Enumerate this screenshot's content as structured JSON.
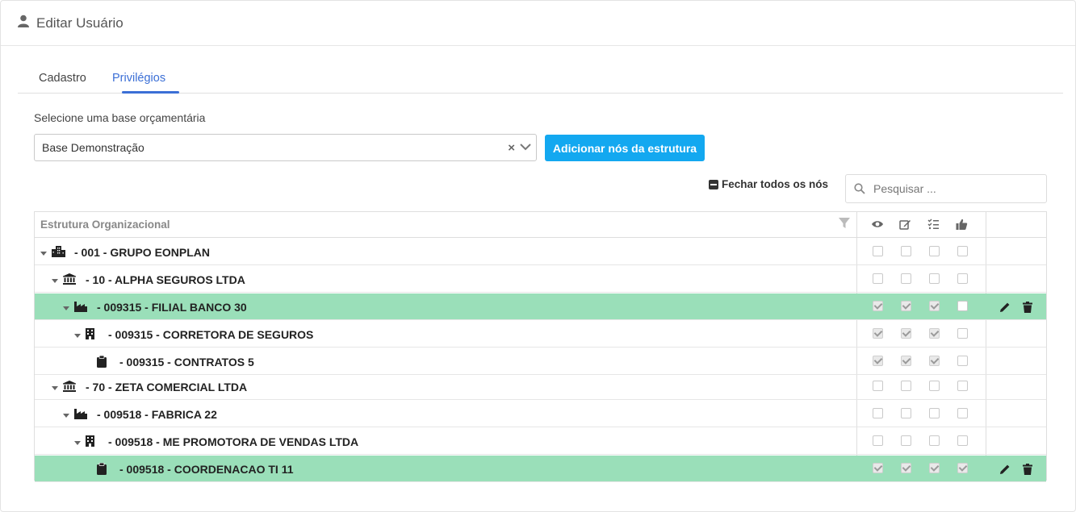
{
  "header": {
    "title": "Editar Usuário",
    "icon": "user-icon"
  },
  "tabs": [
    {
      "label": "Cadastro",
      "active": false
    },
    {
      "label": "Privilégios",
      "active": true
    }
  ],
  "base": {
    "label": "Selecione uma base orçamentária",
    "selected": "Base Demonstração",
    "clear_glyph": "×",
    "add_button": "Adicionar nós da estrutura"
  },
  "toolbar": {
    "close_all_label": "Fechar todos os nós",
    "search_placeholder": "Pesquisar ..."
  },
  "tree": {
    "column_title": "Estrutura Organizacional",
    "permission_icons": [
      "eye-icon",
      "edit-icon",
      "tasks-icon",
      "thumbs-up-icon"
    ],
    "rows": [
      {
        "label": "- 001 - GRUPO EONPLAN",
        "icon": "building-group-icon",
        "expanded": true,
        "highlighted": false,
        "perms": [
          false,
          false,
          false,
          false
        ],
        "actions": false
      },
      {
        "label": "- 10 - ALPHA SEGUROS LTDA",
        "icon": "bank-icon",
        "expanded": true,
        "highlighted": false,
        "perms": [
          false,
          false,
          false,
          false
        ],
        "actions": false
      },
      {
        "label": "- 009315 - FILIAL BANCO 30",
        "icon": "factory-icon",
        "expanded": true,
        "highlighted": true,
        "perms": [
          true,
          true,
          true,
          false
        ],
        "actions": true
      },
      {
        "label": "- 009315 - CORRETORA DE SEGUROS",
        "icon": "building-icon",
        "expanded": true,
        "highlighted": false,
        "perms": [
          true,
          true,
          true,
          false
        ],
        "actions": false
      },
      {
        "label": "- 009315 - CONTRATOS 5",
        "icon": "clipboard-icon",
        "expanded": false,
        "highlighted": false,
        "perms": [
          true,
          true,
          true,
          false
        ],
        "actions": false
      },
      {
        "label": "- 70 - ZETA COMERCIAL LTDA",
        "icon": "bank-icon",
        "expanded": true,
        "highlighted": false,
        "perms": [
          false,
          false,
          false,
          false
        ],
        "actions": false
      },
      {
        "label": "- 009518 - FABRICA 22",
        "icon": "factory-icon",
        "expanded": true,
        "highlighted": false,
        "perms": [
          false,
          false,
          false,
          false
        ],
        "actions": false
      },
      {
        "label": "- 009518 - ME PROMOTORA DE VENDAS LTDA",
        "icon": "building-icon",
        "expanded": true,
        "highlighted": false,
        "perms": [
          false,
          false,
          false,
          false
        ],
        "actions": false
      },
      {
        "label": "- 009518 - COORDENACAO TI 11",
        "icon": "clipboard-icon",
        "expanded": false,
        "highlighted": true,
        "perms": [
          true,
          true,
          true,
          true
        ],
        "actions": true
      }
    ]
  },
  "colors": {
    "accent": "#3b6fd6",
    "button": "#13a8f0",
    "highlight_row": "#9adfb9"
  }
}
